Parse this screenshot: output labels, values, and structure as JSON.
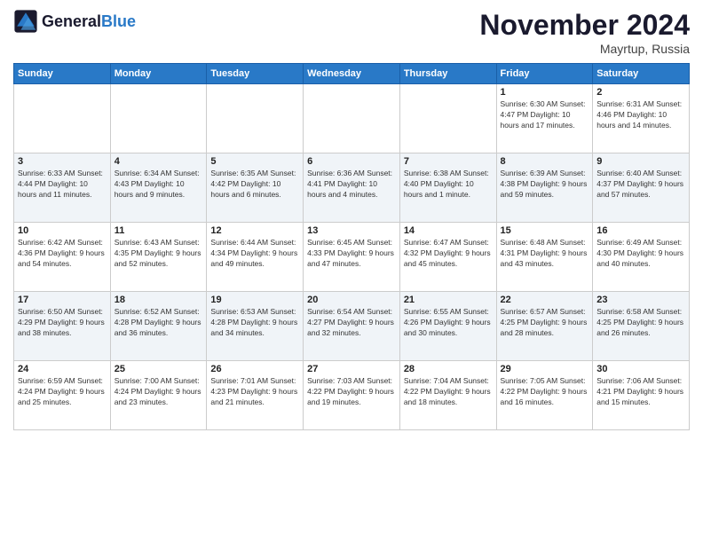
{
  "header": {
    "logo_general": "General",
    "logo_blue": "Blue",
    "month_title": "November 2024",
    "location": "Mayrtup, Russia"
  },
  "days_of_week": [
    "Sunday",
    "Monday",
    "Tuesday",
    "Wednesday",
    "Thursday",
    "Friday",
    "Saturday"
  ],
  "weeks": [
    [
      {
        "day": "",
        "info": ""
      },
      {
        "day": "",
        "info": ""
      },
      {
        "day": "",
        "info": ""
      },
      {
        "day": "",
        "info": ""
      },
      {
        "day": "",
        "info": ""
      },
      {
        "day": "1",
        "info": "Sunrise: 6:30 AM\nSunset: 4:47 PM\nDaylight: 10 hours and 17 minutes."
      },
      {
        "day": "2",
        "info": "Sunrise: 6:31 AM\nSunset: 4:46 PM\nDaylight: 10 hours and 14 minutes."
      }
    ],
    [
      {
        "day": "3",
        "info": "Sunrise: 6:33 AM\nSunset: 4:44 PM\nDaylight: 10 hours and 11 minutes."
      },
      {
        "day": "4",
        "info": "Sunrise: 6:34 AM\nSunset: 4:43 PM\nDaylight: 10 hours and 9 minutes."
      },
      {
        "day": "5",
        "info": "Sunrise: 6:35 AM\nSunset: 4:42 PM\nDaylight: 10 hours and 6 minutes."
      },
      {
        "day": "6",
        "info": "Sunrise: 6:36 AM\nSunset: 4:41 PM\nDaylight: 10 hours and 4 minutes."
      },
      {
        "day": "7",
        "info": "Sunrise: 6:38 AM\nSunset: 4:40 PM\nDaylight: 10 hours and 1 minute."
      },
      {
        "day": "8",
        "info": "Sunrise: 6:39 AM\nSunset: 4:38 PM\nDaylight: 9 hours and 59 minutes."
      },
      {
        "day": "9",
        "info": "Sunrise: 6:40 AM\nSunset: 4:37 PM\nDaylight: 9 hours and 57 minutes."
      }
    ],
    [
      {
        "day": "10",
        "info": "Sunrise: 6:42 AM\nSunset: 4:36 PM\nDaylight: 9 hours and 54 minutes."
      },
      {
        "day": "11",
        "info": "Sunrise: 6:43 AM\nSunset: 4:35 PM\nDaylight: 9 hours and 52 minutes."
      },
      {
        "day": "12",
        "info": "Sunrise: 6:44 AM\nSunset: 4:34 PM\nDaylight: 9 hours and 49 minutes."
      },
      {
        "day": "13",
        "info": "Sunrise: 6:45 AM\nSunset: 4:33 PM\nDaylight: 9 hours and 47 minutes."
      },
      {
        "day": "14",
        "info": "Sunrise: 6:47 AM\nSunset: 4:32 PM\nDaylight: 9 hours and 45 minutes."
      },
      {
        "day": "15",
        "info": "Sunrise: 6:48 AM\nSunset: 4:31 PM\nDaylight: 9 hours and 43 minutes."
      },
      {
        "day": "16",
        "info": "Sunrise: 6:49 AM\nSunset: 4:30 PM\nDaylight: 9 hours and 40 minutes."
      }
    ],
    [
      {
        "day": "17",
        "info": "Sunrise: 6:50 AM\nSunset: 4:29 PM\nDaylight: 9 hours and 38 minutes."
      },
      {
        "day": "18",
        "info": "Sunrise: 6:52 AM\nSunset: 4:28 PM\nDaylight: 9 hours and 36 minutes."
      },
      {
        "day": "19",
        "info": "Sunrise: 6:53 AM\nSunset: 4:28 PM\nDaylight: 9 hours and 34 minutes."
      },
      {
        "day": "20",
        "info": "Sunrise: 6:54 AM\nSunset: 4:27 PM\nDaylight: 9 hours and 32 minutes."
      },
      {
        "day": "21",
        "info": "Sunrise: 6:55 AM\nSunset: 4:26 PM\nDaylight: 9 hours and 30 minutes."
      },
      {
        "day": "22",
        "info": "Sunrise: 6:57 AM\nSunset: 4:25 PM\nDaylight: 9 hours and 28 minutes."
      },
      {
        "day": "23",
        "info": "Sunrise: 6:58 AM\nSunset: 4:25 PM\nDaylight: 9 hours and 26 minutes."
      }
    ],
    [
      {
        "day": "24",
        "info": "Sunrise: 6:59 AM\nSunset: 4:24 PM\nDaylight: 9 hours and 25 minutes."
      },
      {
        "day": "25",
        "info": "Sunrise: 7:00 AM\nSunset: 4:24 PM\nDaylight: 9 hours and 23 minutes."
      },
      {
        "day": "26",
        "info": "Sunrise: 7:01 AM\nSunset: 4:23 PM\nDaylight: 9 hours and 21 minutes."
      },
      {
        "day": "27",
        "info": "Sunrise: 7:03 AM\nSunset: 4:22 PM\nDaylight: 9 hours and 19 minutes."
      },
      {
        "day": "28",
        "info": "Sunrise: 7:04 AM\nSunset: 4:22 PM\nDaylight: 9 hours and 18 minutes."
      },
      {
        "day": "29",
        "info": "Sunrise: 7:05 AM\nSunset: 4:22 PM\nDaylight: 9 hours and 16 minutes."
      },
      {
        "day": "30",
        "info": "Sunrise: 7:06 AM\nSunset: 4:21 PM\nDaylight: 9 hours and 15 minutes."
      }
    ]
  ]
}
